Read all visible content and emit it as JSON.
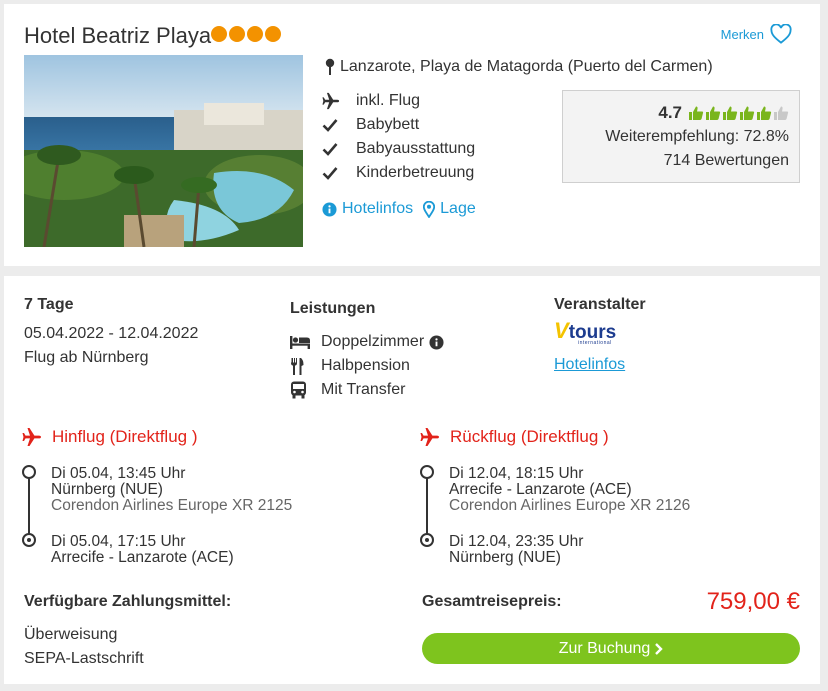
{
  "hotel": {
    "name": "Hotel Beatriz Playa",
    "stars": 4,
    "merken_label": "Merken",
    "location": "Lanzarote, Playa de Matagorda (Puerto del Carmen)",
    "features": [
      {
        "icon": "plane-icon",
        "label": "inkl. Flug"
      },
      {
        "icon": "check-icon",
        "label": "Babybett"
      },
      {
        "icon": "check-icon",
        "label": "Babyausstattung"
      },
      {
        "icon": "check-icon",
        "label": "Kinderbetreuung"
      }
    ],
    "links": {
      "hotelinfos": "Hotelinfos",
      "lage": "Lage"
    },
    "rating": {
      "score": "4.7",
      "thumbs_filled": 5,
      "thumbs_total": 6,
      "recommendation": "Weiterempfehlung: 72.8%",
      "reviews": "714 Bewertungen"
    }
  },
  "trip": {
    "duration": "7 Tage",
    "dates": "05.04.2022 - 12.04.2022",
    "departure": "Flug ab Nürnberg"
  },
  "leistungen": {
    "title": "Leistungen",
    "items": [
      {
        "icon": "bed-icon",
        "label": "Doppelzimmer",
        "info": true
      },
      {
        "icon": "cutlery-icon",
        "label": "Halbpension",
        "info": false
      },
      {
        "icon": "bus-icon",
        "label": "Mit Transfer",
        "info": false
      }
    ]
  },
  "veranstalter": {
    "title": "Veranstalter",
    "logo_text": "tours",
    "logo_sub": "international",
    "link": "Hotelinfos"
  },
  "hinflug": {
    "title": "Hinflug (Direktflug )",
    "dep_time": "Di 05.04, 13:45 Uhr",
    "dep_airport": "Nürnberg (NUE)",
    "airline": "Corendon Airlines Europe XR 2125",
    "arr_time": "Di 05.04, 17:15 Uhr",
    "arr_airport": "Arrecife - Lanzarote (ACE)"
  },
  "rueckflug": {
    "title": "Rückflug (Direktflug )",
    "dep_time": "Di 12.04, 18:15 Uhr",
    "dep_airport": "Arrecife - Lanzarote (ACE)",
    "airline": "Corendon Airlines Europe XR 2126",
    "arr_time": "Di 12.04, 23:35 Uhr",
    "arr_airport": "Nürnberg (NUE)"
  },
  "payment": {
    "title": "Verfügbare Zahlungsmittel:",
    "methods": [
      "Überweisung",
      "SEPA-Lastschrift"
    ]
  },
  "price": {
    "label": "Gesamtreisepreis:",
    "value": "759,00 €"
  },
  "booking_button": "Zur Buchung",
  "colors": {
    "accent_blue": "#1b9ad6",
    "star_orange": "#f39200",
    "flight_red": "#e2231a",
    "button_green": "#7ec41e",
    "thumb_green": "#7ab51d"
  }
}
